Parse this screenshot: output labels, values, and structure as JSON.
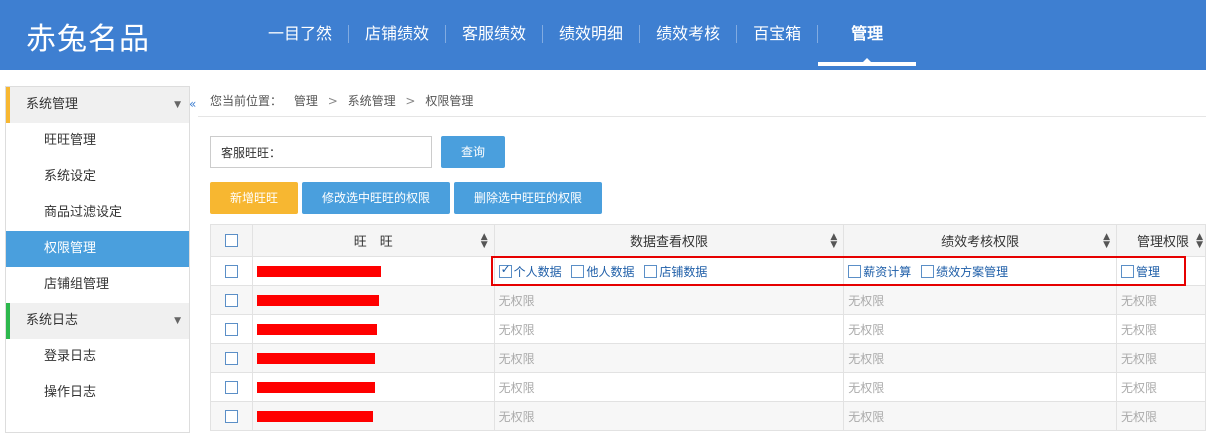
{
  "header": {
    "logo": "赤兔名品",
    "nav": [
      "一目了然",
      "店铺绩效",
      "客服绩效",
      "绩效明细",
      "绩效考核",
      "百宝箱",
      "管理"
    ],
    "active_nav": "管理"
  },
  "sidebar": {
    "collapse_icon": "«",
    "groups": [
      {
        "label": "系统管理",
        "accent": "#f7b731",
        "items": [
          "旺旺管理",
          "系统设定",
          "商品过滤设定",
          "权限管理",
          "店铺组管理"
        ],
        "active": "权限管理"
      },
      {
        "label": "系统日志",
        "accent": "#2db84d",
        "items": [
          "登录日志",
          "操作日志"
        ]
      }
    ]
  },
  "breadcrumb": {
    "prefix": "您当前位置：",
    "items": [
      "管理",
      "系统管理",
      "权限管理"
    ]
  },
  "search": {
    "label": "客服旺旺：",
    "button": "查询"
  },
  "actions": {
    "add": "新增旺旺",
    "edit": "修改选中旺旺的权限",
    "delete": "删除选中旺旺的权限"
  },
  "table": {
    "headers": [
      "旺　旺",
      "数据查看权限",
      "绩效考核权限",
      "管理权限"
    ],
    "no_permission": "无权限",
    "first_row": {
      "data_perms": [
        {
          "label": "个人数据",
          "checked": true
        },
        {
          "label": "他人数据",
          "checked": false
        },
        {
          "label": "店铺数据",
          "checked": false
        }
      ],
      "perf_perms": [
        {
          "label": "薪资计算",
          "checked": false
        },
        {
          "label": "绩效方案管理",
          "checked": false
        }
      ],
      "admin_perms": [
        {
          "label": "管理",
          "checked": false
        }
      ]
    },
    "row_count": 6
  },
  "colors": {
    "header_bg": "#3e7fd1",
    "primary": "#4a9fdd",
    "warning": "#f7b731",
    "highlight": "#e60000",
    "redact": "#ff0000"
  }
}
